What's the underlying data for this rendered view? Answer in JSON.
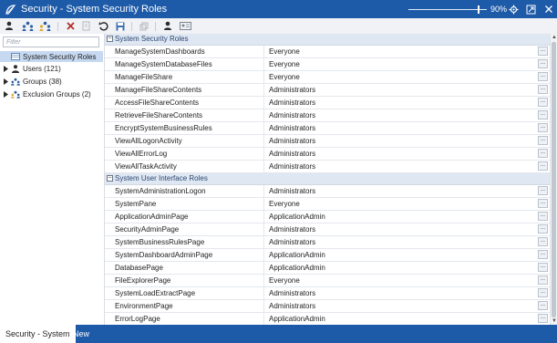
{
  "window": {
    "title": "Security - System Security Roles",
    "zoom": "90%",
    "zoom_fraction": 0.9
  },
  "toolbar": {
    "icons": [
      "user-icon",
      "users-icon",
      "user-group-icon",
      "delete-icon",
      "copy-icon",
      "undo-icon",
      "save-icon",
      "copy-row-icon",
      "user-lock-icon",
      "id-card-icon"
    ]
  },
  "sidebar": {
    "filter_placeholder": "Filter",
    "items": [
      {
        "label": "System Security Roles",
        "selected": true
      },
      {
        "label": "Users (121)"
      },
      {
        "label": "Groups (38)"
      },
      {
        "label": "Exclusion Groups (2)"
      }
    ]
  },
  "grid": {
    "groups": [
      {
        "title": "System Security Roles",
        "rows": [
          {
            "name": "ManageSystemDashboards",
            "value": "Everyone"
          },
          {
            "name": "ManageSystemDatabaseFiles",
            "value": "Everyone"
          },
          {
            "name": "ManageFileShare",
            "value": "Everyone"
          },
          {
            "name": "ManageFileShareContents",
            "value": "Administrators"
          },
          {
            "name": "AccessFileShareContents",
            "value": "Administrators"
          },
          {
            "name": "RetrieveFileShareContents",
            "value": "Administrators"
          },
          {
            "name": "EncryptSystemBusinessRules",
            "value": "Administrators"
          },
          {
            "name": "ViewAllLogonActivity",
            "value": "Administrators"
          },
          {
            "name": "ViewAllErrorLog",
            "value": "Administrators"
          },
          {
            "name": "ViewAllTaskActivity",
            "value": "Administrators"
          }
        ]
      },
      {
        "title": "System User Interface Roles",
        "rows": [
          {
            "name": "SystemAdministrationLogon",
            "value": "Administrators"
          },
          {
            "name": "SystemPane",
            "value": "Everyone"
          },
          {
            "name": "ApplicationAdminPage",
            "value": "ApplicationAdmin"
          },
          {
            "name": "SecurityAdminPage",
            "value": "Administrators"
          },
          {
            "name": "SystemBusinessRulesPage",
            "value": "Administrators"
          },
          {
            "name": "SystemDashboardAdminPage",
            "value": "ApplicationAdmin"
          },
          {
            "name": "DatabasePage",
            "value": "ApplicationAdmin"
          },
          {
            "name": "FileExplorerPage",
            "value": "Everyone"
          },
          {
            "name": "SystemLoadExtractPage",
            "value": "Administrators"
          },
          {
            "name": "EnvironmentPage",
            "value": "Administrators"
          },
          {
            "name": "ErrorLogPage",
            "value": "ApplicationAdmin"
          }
        ]
      }
    ],
    "ellipsis_label": "..."
  },
  "tabs": {
    "active": "Security - System",
    "new": "New"
  },
  "colors": {
    "accent": "#1d5aa8",
    "selected": "#c6d9f1",
    "group_header": "#dfe7f3"
  }
}
